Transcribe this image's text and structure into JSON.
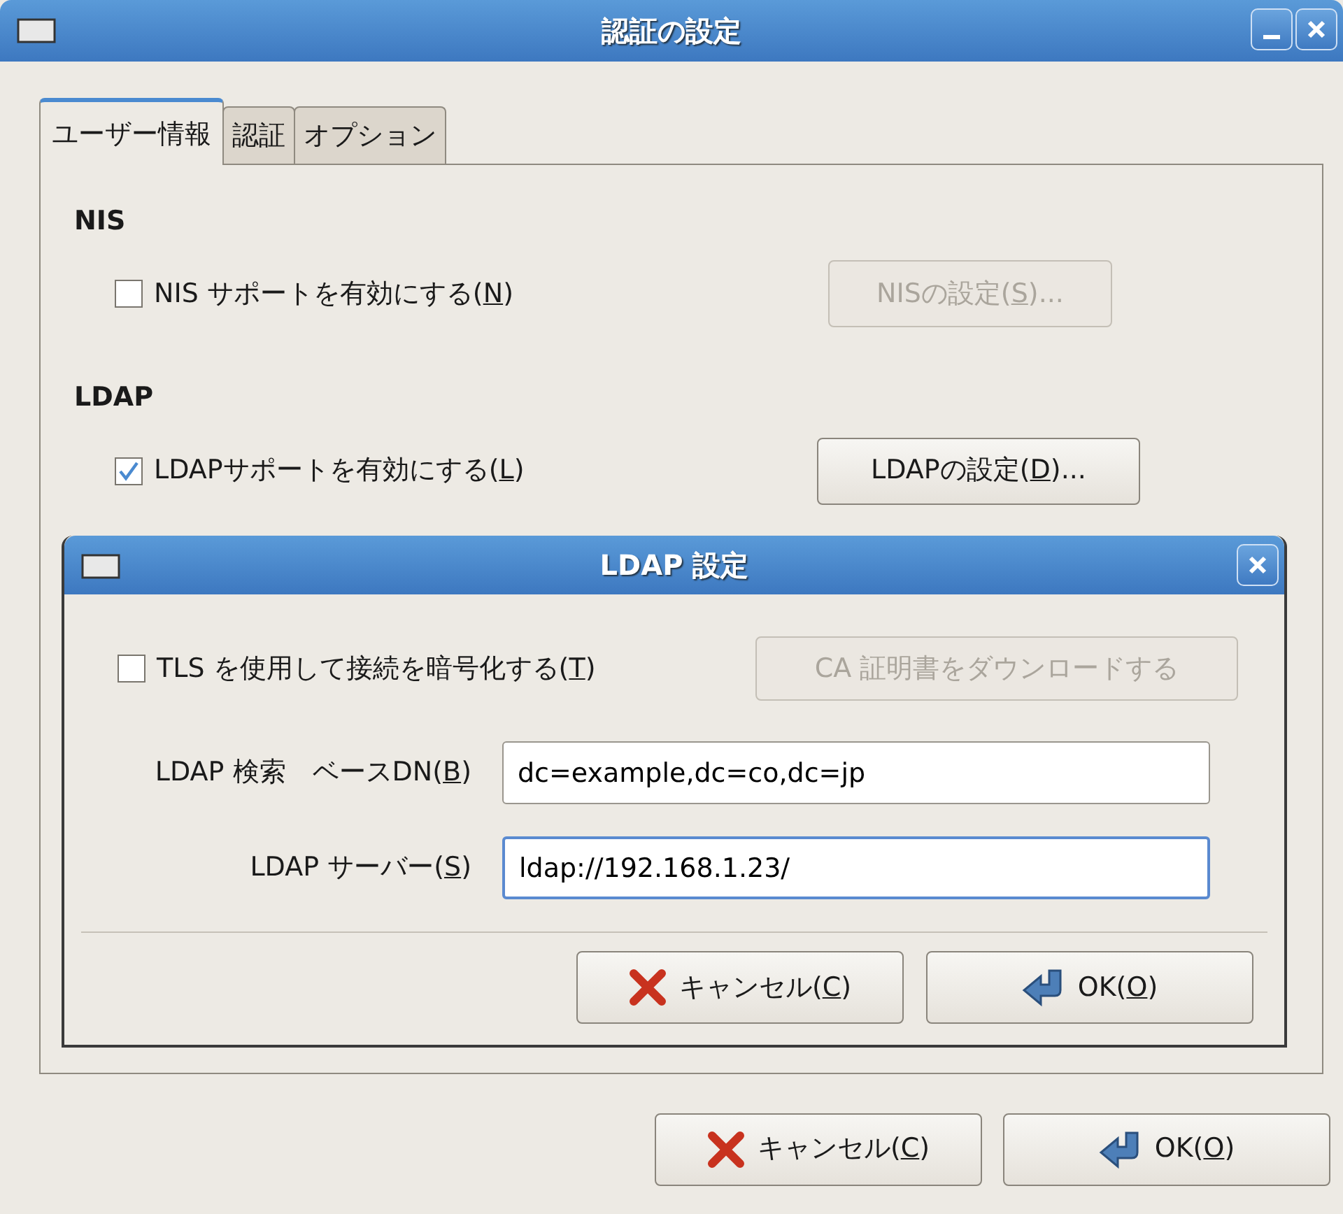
{
  "window": {
    "title": "認証の設定"
  },
  "tabs": [
    {
      "label": "ユーザー情報",
      "selected": true
    },
    {
      "label": "認証",
      "selected": false
    },
    {
      "label": "オプション",
      "selected": false
    }
  ],
  "sections": [
    {
      "heading": "NIS",
      "option": {
        "label": {
          "pre": "NIS サポートを有効にする(",
          "key": "N",
          "post": ")"
        },
        "checked": false
      },
      "button": {
        "label": {
          "pre": "NISの設定(",
          "key": "S",
          "post": ")..."
        },
        "disabled": true
      }
    },
    {
      "heading": "LDAP",
      "option": {
        "label": {
          "pre": "LDAPサポートを有効にする(",
          "key": "L",
          "post": ")"
        },
        "checked": true
      },
      "button": {
        "label": {
          "pre": "LDAPの設定(",
          "key": "D",
          "post": ")..."
        },
        "disabled": false
      }
    }
  ],
  "dialog": {
    "title": "LDAP 設定",
    "tls": {
      "label": {
        "pre": "TLS を使用して接続を暗号化する(",
        "key": "T",
        "post": ")"
      },
      "checked": false
    },
    "ca_button": {
      "label": {
        "pre": "CA 証明書をダウンロードする"
      },
      "disabled": true
    },
    "fields": [
      {
        "label": {
          "pre": "LDAP 検索　ベースDN(",
          "key": "B",
          "post": ")"
        },
        "value": "dc=example,dc=co,dc=jp",
        "focused": false
      },
      {
        "label": {
          "pre": "LDAP サーバー(",
          "key": "S",
          "post": ")"
        },
        "value": "ldap://192.168.1.23/",
        "focused": true
      }
    ],
    "buttons": [
      {
        "kind": "cancel",
        "label": {
          "pre": "キャンセル(",
          "key": "C",
          "post": ")"
        }
      },
      {
        "kind": "ok",
        "label": {
          "pre": "OK(",
          "key": "O",
          "post": ")"
        }
      }
    ]
  },
  "buttons": [
    {
      "kind": "cancel",
      "label": {
        "pre": "キャンセル(",
        "key": "C",
        "post": ")"
      }
    },
    {
      "kind": "ok",
      "label": {
        "pre": "OK(",
        "key": "O",
        "post": ")"
      }
    }
  ]
}
